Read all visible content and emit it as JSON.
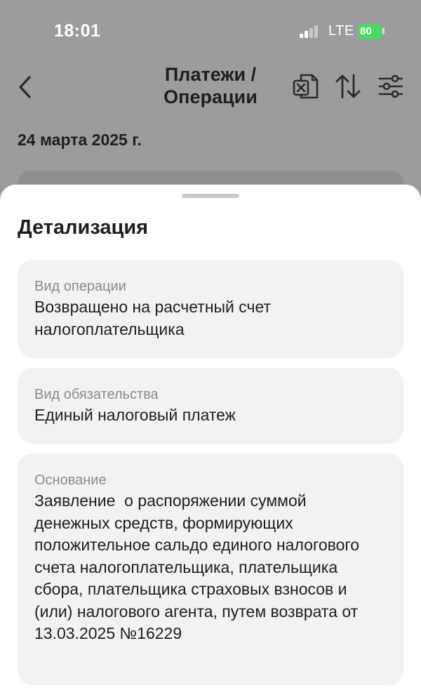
{
  "status_bar": {
    "time": "18:01",
    "network": "LTE",
    "battery": "80"
  },
  "nav": {
    "title": "Платежи / Операции",
    "icons": [
      "back-chevron-icon",
      "excel-export-icon",
      "sort-icon",
      "filter-icon"
    ]
  },
  "list": {
    "date_header": "24 марта 2025 г."
  },
  "sheet": {
    "title": "Детализация",
    "fields": [
      {
        "label": "Вид операции",
        "value": "Возвращено на расчетный счет налогоплательщика"
      },
      {
        "label": "Вид обязательства",
        "value": "Единый налоговый платеж"
      },
      {
        "label": "Основание",
        "value": "Заявление  о распоряжении суммой денежных средств, формирующих положительное сальдо единого налогового счета налогоплательщика, плательщика сбора, плательщика страховых взносов и (или) налогового агента, путем возврата от 13.03.2025 №16229"
      }
    ]
  },
  "colors": {
    "overlay": "#9c9c9c",
    "sheet": "#ffffff",
    "card": "#f2f2f3",
    "text": "#1e1e1e",
    "label": "#8b8b8e",
    "battery": "#4cd964"
  }
}
